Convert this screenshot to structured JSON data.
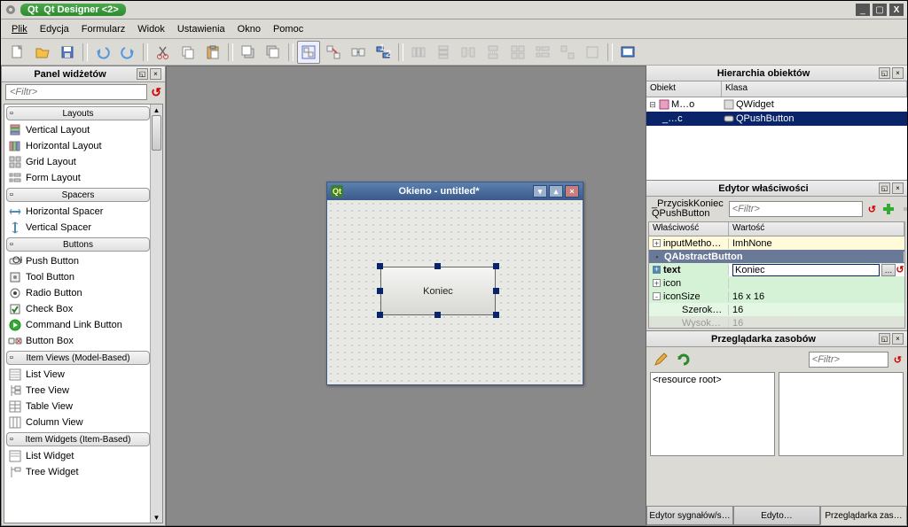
{
  "window": {
    "title": "Qt Designer <2>"
  },
  "titlebar_buttons": {
    "min": "_",
    "max": "▢",
    "close": "X"
  },
  "menu": [
    "Plik",
    "Edycja",
    "Formularz",
    "Widok",
    "Ustawienia",
    "Okno",
    "Pomoc"
  ],
  "widget_box": {
    "title": "Panel widżetów",
    "filter_placeholder": "<Filtr>",
    "categories": [
      {
        "name": "Layouts",
        "items": [
          "Vertical Layout",
          "Horizontal Layout",
          "Grid Layout",
          "Form Layout"
        ]
      },
      {
        "name": "Spacers",
        "items": [
          "Horizontal Spacer",
          "Vertical Spacer"
        ]
      },
      {
        "name": "Buttons",
        "items": [
          "Push Button",
          "Tool Button",
          "Radio Button",
          "Check Box",
          "Command Link Button",
          "Button Box"
        ]
      },
      {
        "name": "Item Views (Model-Based)",
        "items": [
          "List View",
          "Tree View",
          "Table View",
          "Column View"
        ]
      },
      {
        "name": "Item Widgets (Item-Based)",
        "items": [
          "List Widget",
          "Tree Widget"
        ]
      }
    ]
  },
  "form": {
    "title": "Okieno - untitled*",
    "button_text": "Koniec"
  },
  "object_inspector": {
    "title": "Hierarchia obiektów",
    "columns": [
      "Obiekt",
      "Klasa"
    ],
    "rows": [
      {
        "obj": "M…o",
        "klass": "QWidget",
        "depth": 0,
        "selected": false
      },
      {
        "obj": "_…c",
        "klass": "QPushButton",
        "depth": 1,
        "selected": true
      }
    ]
  },
  "property_editor": {
    "title": "Edytor właściwości",
    "object_name": "_PrzyciskKoniec",
    "class_name": "QPushButton",
    "filter_placeholder": "<Filtr>",
    "columns": [
      "Właściwość",
      "Wartość"
    ],
    "rows": [
      {
        "kind": "yellow",
        "name": "inputMetho…",
        "value": "ImhNone",
        "exp": "+"
      },
      {
        "kind": "sect",
        "name": "QAbstractButton"
      },
      {
        "kind": "seltxt",
        "name": "text",
        "value": "Koniec",
        "exp": "+"
      },
      {
        "kind": "green",
        "name": "icon",
        "value": "",
        "exp": "+"
      },
      {
        "kind": "green",
        "name": "iconSize",
        "value": "16 x 16",
        "exp": "-"
      },
      {
        "kind": "gsub",
        "name": "Szerok…",
        "value": "16"
      },
      {
        "kind": "gsub",
        "name": "Wysok…",
        "value": "16",
        "faded": true
      }
    ]
  },
  "resource_browser": {
    "title": "Przeglądarka zasobów",
    "filter_placeholder": "<Filtr>",
    "root_label": "<resource root>"
  },
  "bottom_tabs": [
    "Edytor sygnałów/s…",
    "Edyto…",
    "Przeglądarka zas…"
  ],
  "icons": {
    "new": "new-file-icon",
    "open": "open-folder-icon",
    "save": "save-icon",
    "undo": "undo-icon",
    "redo": "redo-icon",
    "cut": "cut-icon",
    "copy": "copy-icon",
    "paste": "paste-icon",
    "send_back": "send-to-back-icon",
    "bring_front": "bring-to-front-icon",
    "edit_widgets": "edit-widgets-icon",
    "edit_signals": "edit-signals-icon",
    "edit_buddies": "edit-buddies-icon",
    "edit_tab": "edit-tab-order-icon",
    "lay_h": "layout-horizontal-icon",
    "lay_v": "layout-vertical-icon",
    "lay_hs": "layout-h-splitter-icon",
    "lay_vs": "layout-v-splitter-icon",
    "lay_g": "layout-grid-icon",
    "lay_f": "layout-form-icon",
    "lay_break": "break-layout-icon",
    "adjust": "adjust-size-icon",
    "preview": "preview-icon"
  }
}
